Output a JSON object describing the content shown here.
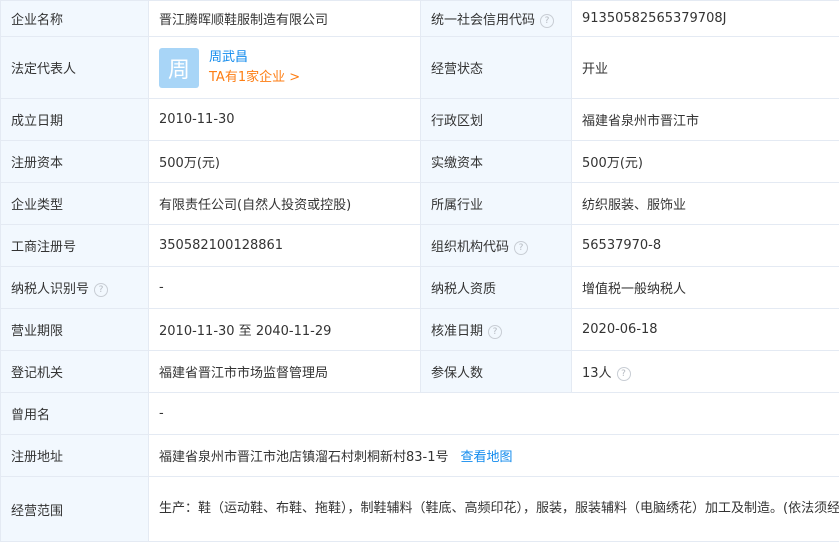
{
  "rows": [
    {
      "l1": "企业名称",
      "v1": "晋江腾晖顺鞋服制造有限公司",
      "l2": "统一社会信用代码",
      "v2": "91350582565379708J"
    },
    {
      "l1": "法定代表人",
      "l2": "经营状态",
      "v2": "开业"
    },
    {
      "l1": "成立日期",
      "v1": "2010-11-30",
      "l2": "行政区划",
      "v2": "福建省泉州市晋江市"
    },
    {
      "l1": "注册资本",
      "v1": "500万(元)",
      "l2": "实缴资本",
      "v2": "500万(元)"
    },
    {
      "l1": "企业类型",
      "v1": "有限责任公司(自然人投资或控股)",
      "l2": "所属行业",
      "v2": "纺织服装、服饰业"
    },
    {
      "l1": "工商注册号",
      "v1": "350582100128861",
      "l2": "组织机构代码",
      "v2": "56537970-8"
    },
    {
      "l1": "纳税人识别号",
      "v1": "-",
      "l2": "纳税人资质",
      "v2": "增值税一般纳税人"
    },
    {
      "l1": "营业期限",
      "v1": "2010-11-30 至 2040-11-29",
      "l2": "核准日期",
      "v2": "2020-06-18"
    },
    {
      "l1": "登记机关",
      "v1": "福建省晋江市市场监督管理局",
      "l2": "参保人数",
      "v2": "13人"
    }
  ],
  "used_name": {
    "label": "曾用名",
    "value": "-"
  },
  "address": {
    "label": "注册地址",
    "value": "福建省泉州市晋江市池店镇溜石村刺桐新村83-1号",
    "map_link": "查看地图"
  },
  "scope": {
    "label": "经营范围",
    "value": "生产：鞋（运动鞋、布鞋、拖鞋），制鞋辅料（鞋底、高频印花），服装，服装辅料（电脑绣花）加工及制造。(依法须经批准的项目，经相关部门批准后方可开展经营活动)"
  },
  "legal_rep": {
    "avatar_char": "周",
    "name": "周武昌",
    "companies_link": "TA有1家企业 >"
  },
  "help_glyph": "?",
  "icons": {
    "help": "question-circle-icon",
    "avatar": "avatar-icon"
  },
  "colors": {
    "label_bg": "#f2f8fe",
    "border": "#e4eaf3",
    "link": "#128bed",
    "accent_orange": "#fd7e14",
    "avatar_bg": "#a8d5f7"
  }
}
